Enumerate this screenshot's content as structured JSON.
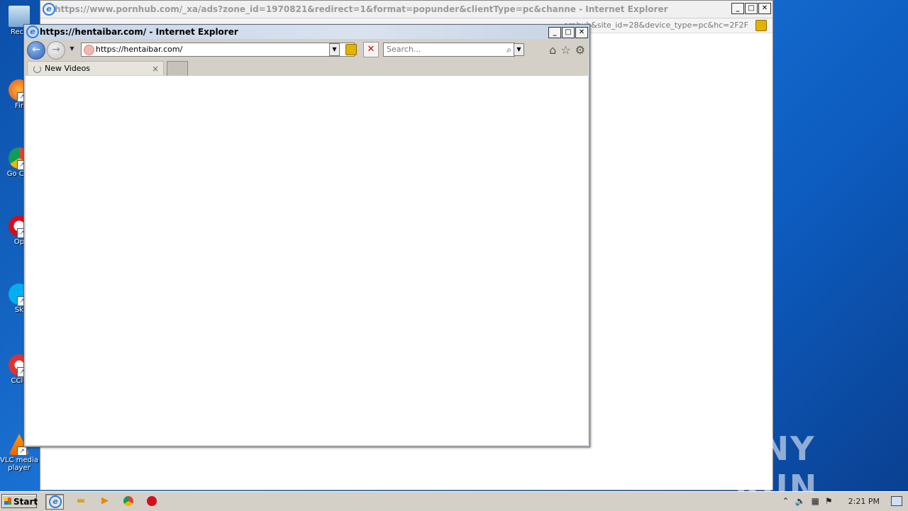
{
  "desktop": {
    "icons": [
      {
        "label": "Recy"
      },
      {
        "label": "Fir"
      },
      {
        "label": "Go Chr"
      },
      {
        "label": "Op"
      },
      {
        "label": "Sk"
      },
      {
        "label": "CCle"
      },
      {
        "label": "VLC media player"
      }
    ]
  },
  "back_window": {
    "title": "https://www.pornhub.com/_xa/ads?zone_id=1970821&redirect=1&format=popunder&clientType=pc&channe - Internet Explorer",
    "address_fragment": "ornhub&site_id=28&device_type=pc&hc=2F2F"
  },
  "front_window": {
    "title": "https://hentaibar.com/ - Internet Explorer",
    "url": "https://hentaibar.com/",
    "search_placeholder": "Search...",
    "tab_label": "New Videos"
  },
  "taskbar": {
    "start_label": "Start",
    "clock": "2:21 PM"
  },
  "watermark": "ANY RUN",
  "colors": {
    "desktop_bg": "#1b74d6",
    "titlebar_active": "#c7d5e8",
    "chrome": "#d4d0c8"
  }
}
